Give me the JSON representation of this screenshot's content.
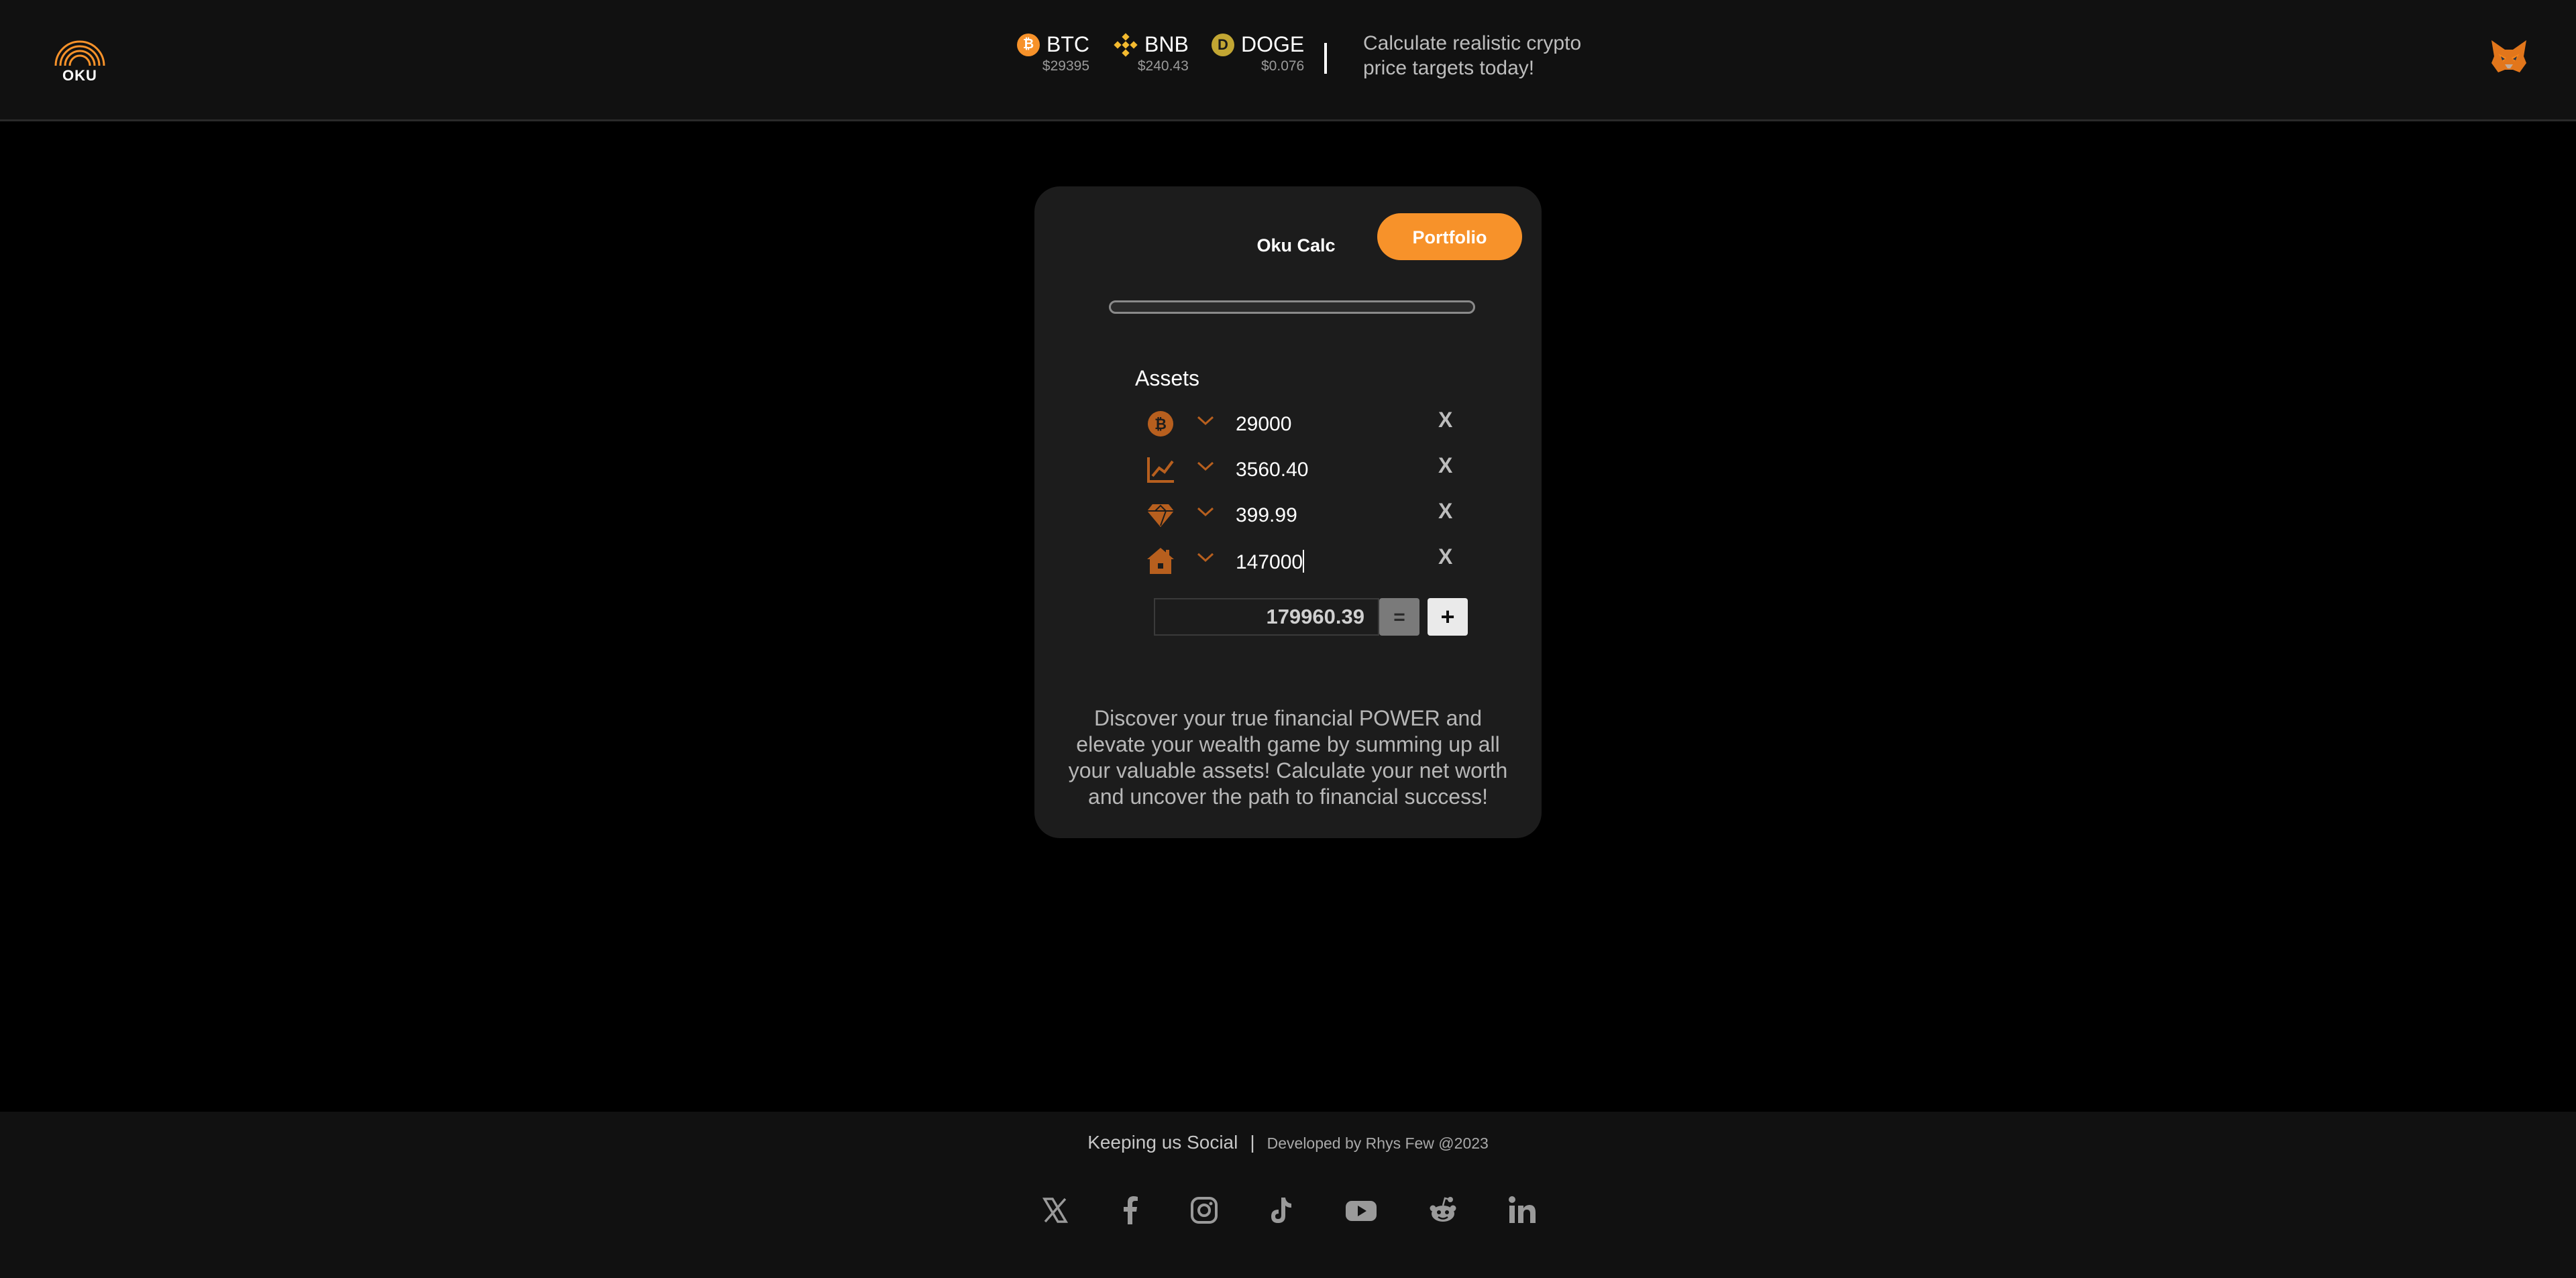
{
  "colors": {
    "accent": "#f7922a",
    "bg": "#000000",
    "panel": "#1c1c1c",
    "bar": "#111111"
  },
  "header": {
    "logo_text": "OKU",
    "tickers": [
      {
        "symbol": "BTC",
        "price": "$29395",
        "icon": "bitcoin-icon"
      },
      {
        "symbol": "BNB",
        "price": "$240.43",
        "icon": "bnb-icon"
      },
      {
        "symbol": "DOGE",
        "price": "$0.076",
        "icon": "dogecoin-icon"
      }
    ],
    "tagline_line1": "Calculate realistic crypto",
    "tagline_line2": "price targets today!",
    "wallet_icon": "metamask-fox-icon"
  },
  "card": {
    "tab_calc": "Oku Calc",
    "tab_portfolio": "Portfolio",
    "assets_label": "Assets",
    "assets": [
      {
        "icon": "bitcoin-icon",
        "value": "29000",
        "remove": "X"
      },
      {
        "icon": "stocks-chart-icon",
        "value": "3560.40",
        "remove": "X"
      },
      {
        "icon": "gem-icon",
        "value": "399.99",
        "remove": "X"
      },
      {
        "icon": "house-icon",
        "value": "147000",
        "remove": "X"
      }
    ],
    "total": "179960.39",
    "equals_label": "=",
    "add_label": "+",
    "description": "Discover your true financial POWER and elevate your wealth game by summing up all your valuable assets! Calculate your net worth and uncover the path to financial success!"
  },
  "footer": {
    "social_text": "Keeping us Social",
    "separator": "|",
    "developer": "Developed by Rhys Few @2023",
    "social_icons": [
      "x-icon",
      "facebook-icon",
      "instagram-icon",
      "tiktok-icon",
      "youtube-icon",
      "reddit-icon",
      "linkedin-icon"
    ]
  }
}
